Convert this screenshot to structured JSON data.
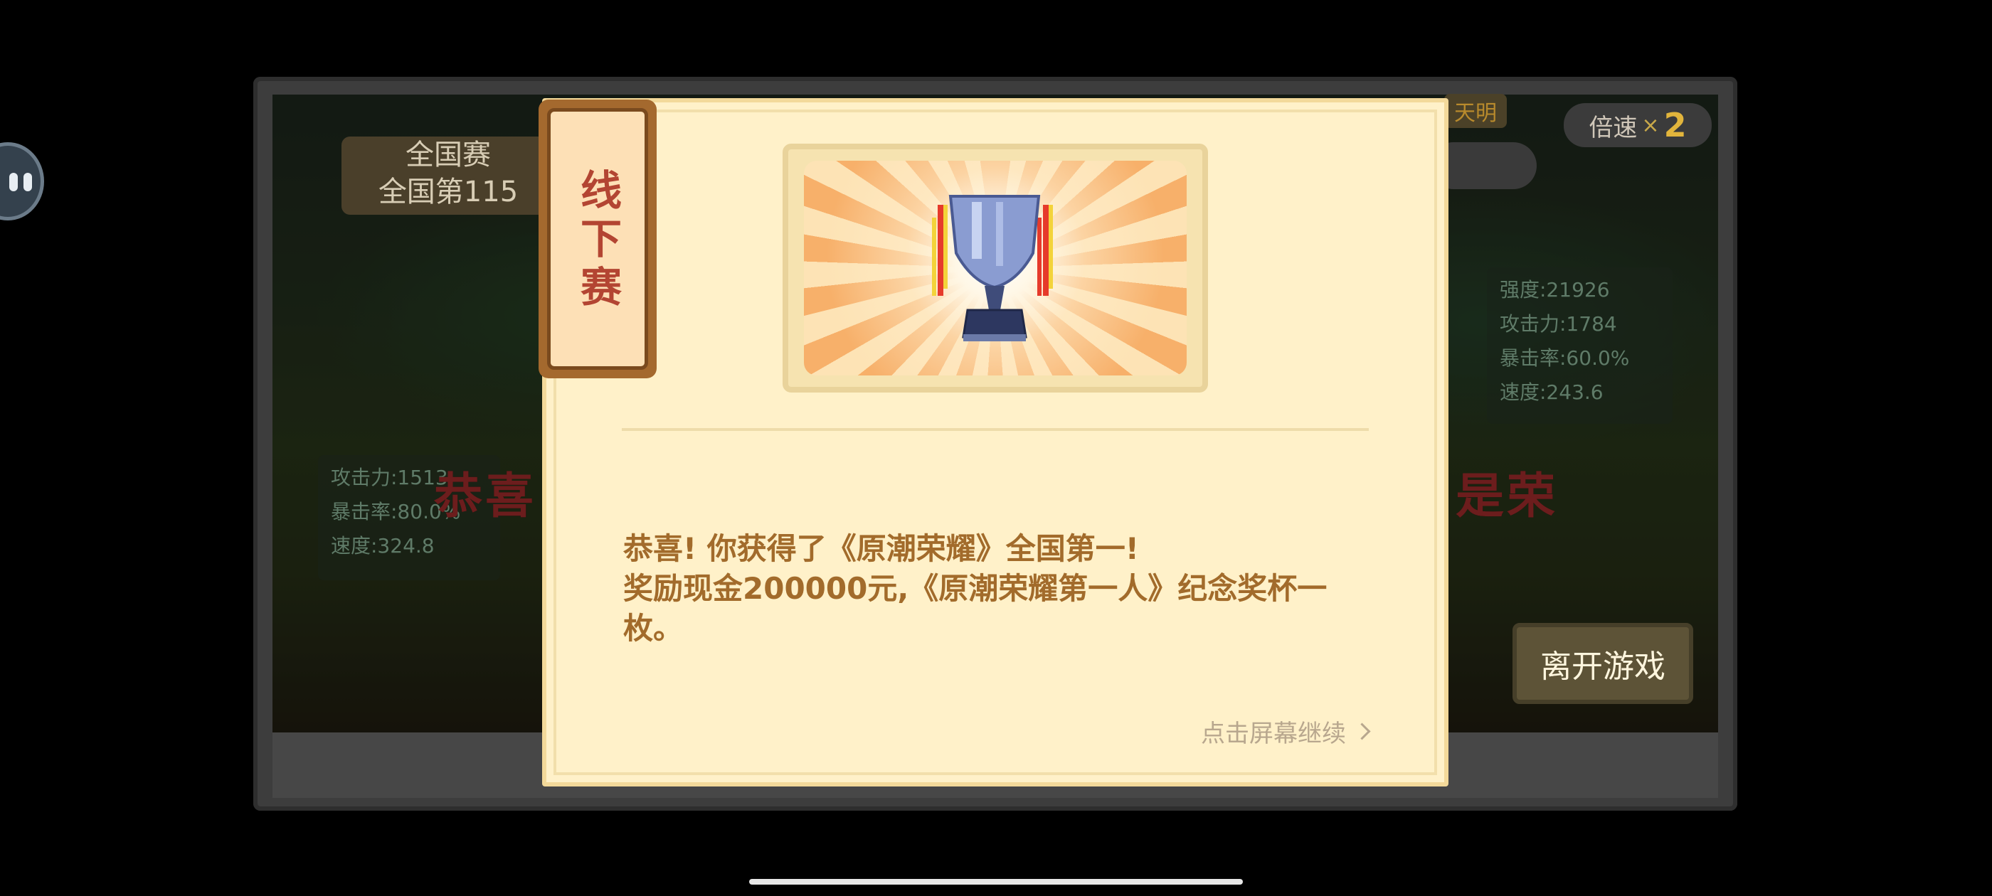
{
  "background": {
    "rank_panel": {
      "line1": "全国赛",
      "line2": "全国第115"
    },
    "speed": {
      "label": "倍速",
      "times": "×",
      "value": "2"
    },
    "top_label": "天明",
    "stats_left": [
      "攻击力:1513",
      "暴击率:80.0%",
      "速度:324.8"
    ],
    "stats_right": [
      "强度:21926",
      "攻击力:1784",
      "暴击率:60.0%",
      "速度:243.6"
    ],
    "banner_left": "恭喜",
    "banner_right": "是荣",
    "leave_button": "离开游戏"
  },
  "modal": {
    "tag": "线下赛",
    "message_line1": "恭喜! 你获得了《原潮荣耀》全国第一!",
    "message_line2": "奖励现金200000元,《原潮荣耀第一人》纪念奖杯一枚。",
    "continue_label": "点击屏幕继续"
  },
  "colors": {
    "modal_bg": "#fff1c9",
    "accent": "#a26b2b",
    "tag_text": "#b34532"
  },
  "icons": [
    "chat-bubble-icon",
    "trophy-icon",
    "chevron-right-icon"
  ]
}
